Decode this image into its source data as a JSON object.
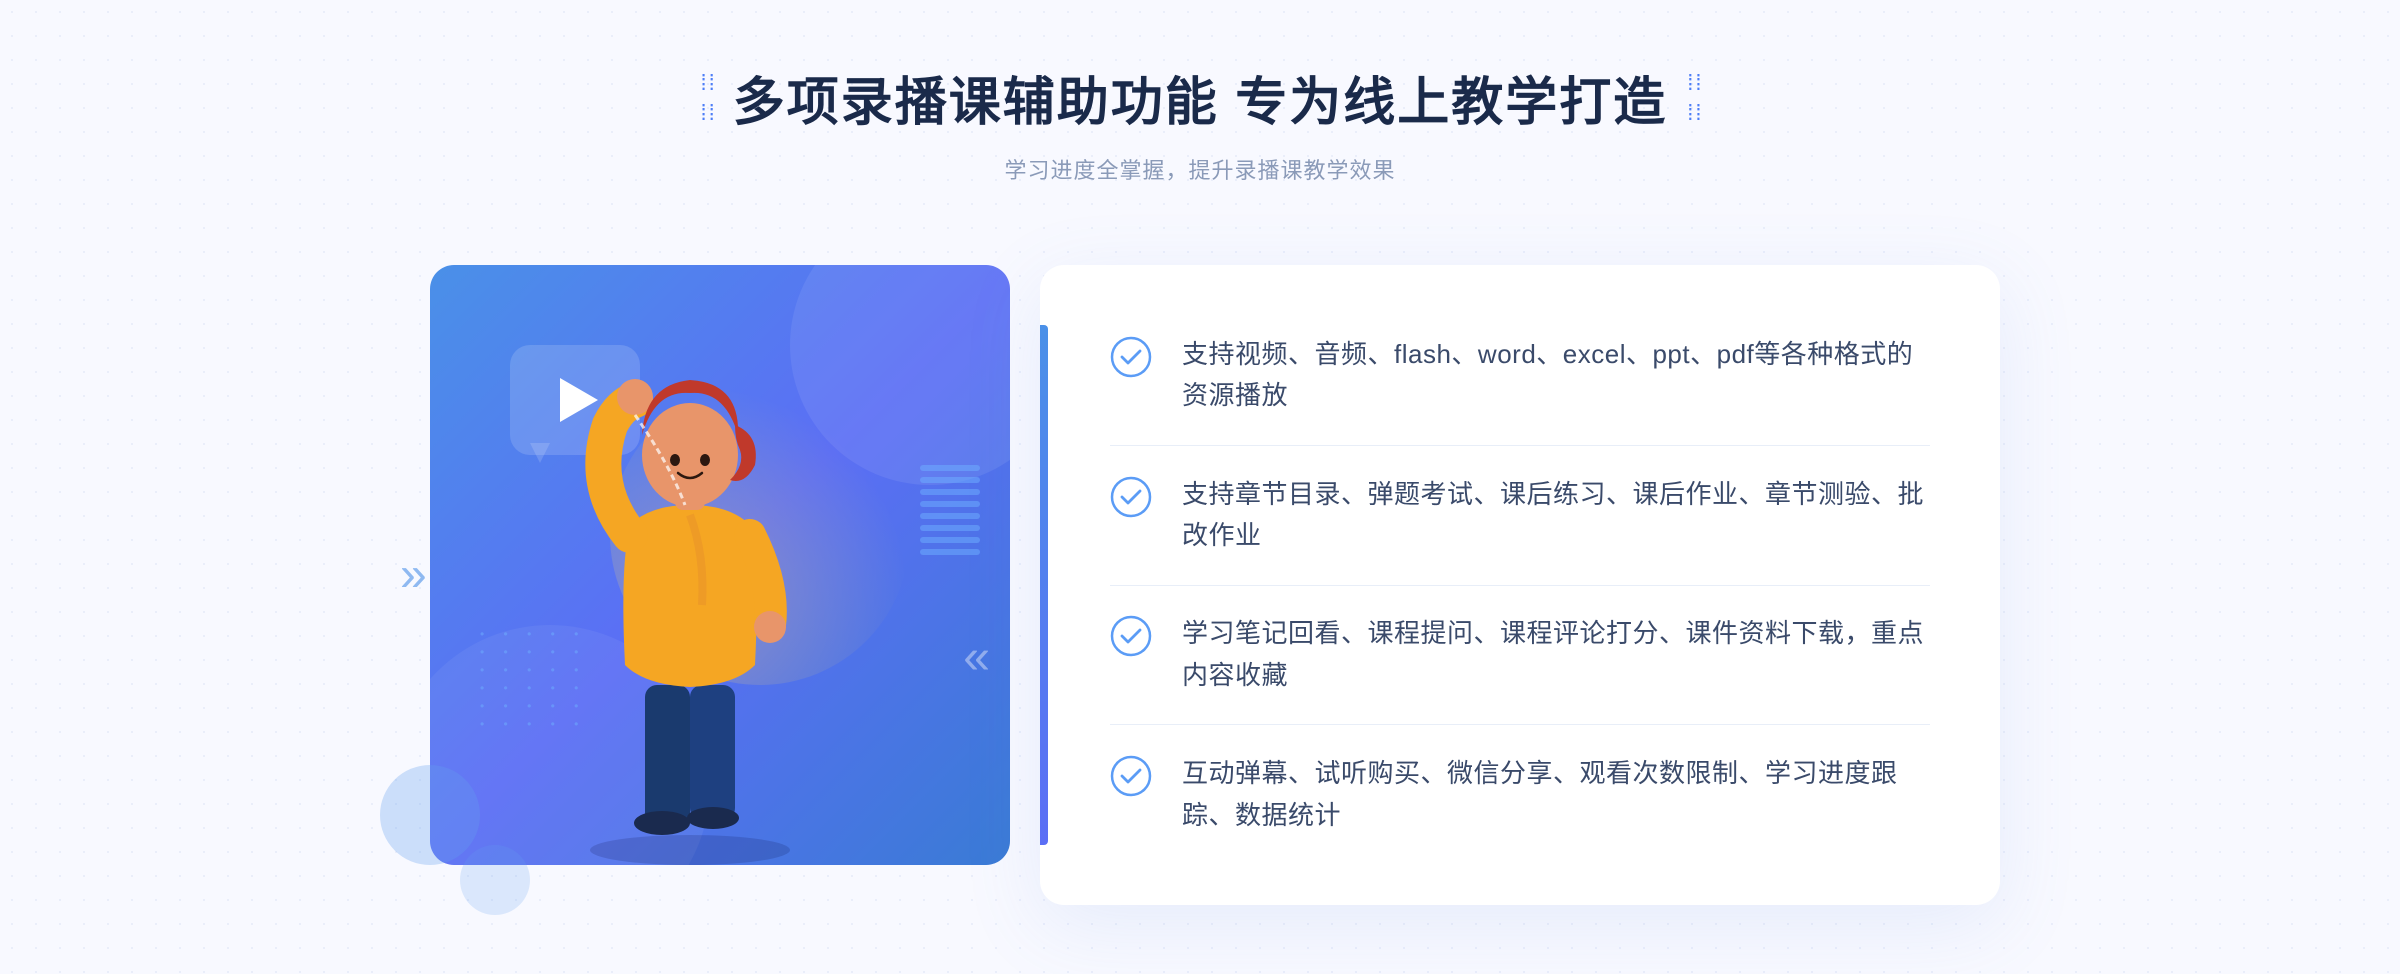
{
  "header": {
    "title": "多项录播课辅助功能 专为线上教学打造",
    "subtitle": "学习进度全掌握，提升录播课教学效果",
    "left_dots": "⁞⁞",
    "right_dots": "⁞⁞"
  },
  "features": [
    {
      "id": 1,
      "text": "支持视频、音频、flash、word、excel、ppt、pdf等各种格式的资源播放"
    },
    {
      "id": 2,
      "text": "支持章节目录、弹题考试、课后练习、课后作业、章节测验、批改作业"
    },
    {
      "id": 3,
      "text": "学习笔记回看、课程提问、课程评论打分、课件资料下载，重点内容收藏"
    },
    {
      "id": 4,
      "text": "互动弹幕、试听购买、微信分享、观看次数限制、学习进度跟踪、数据统计"
    }
  ],
  "colors": {
    "primary_blue": "#4a90e8",
    "dark_blue": "#1a2a4a",
    "text_gray": "#8a9ab8",
    "feature_text": "#3a4a6a",
    "check_color": "#5b9cf6"
  }
}
